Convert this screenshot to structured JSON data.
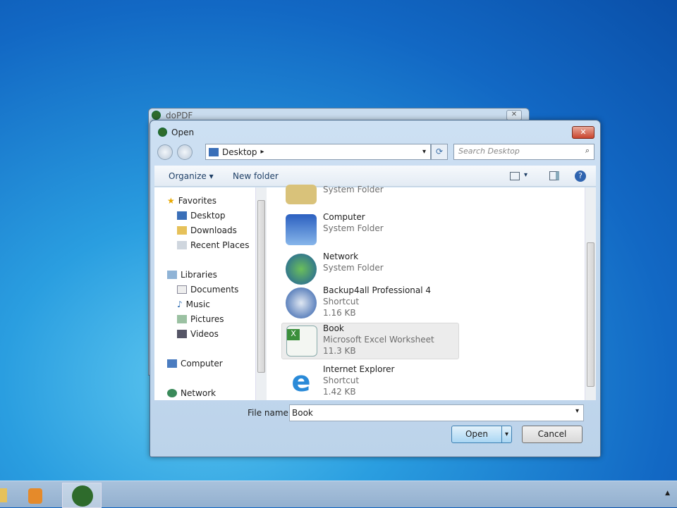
{
  "background_window": {
    "title": "doPDF",
    "close": "✕"
  },
  "dialog": {
    "title": "Open",
    "close": "✕",
    "address": {
      "path": "Desktop",
      "arrow": "▸",
      "dropdown": "▾",
      "refresh": "⟳"
    },
    "search": {
      "placeholder": "Search Desktop",
      "icon": "⌕"
    },
    "toolbar": {
      "organize": "Organize ▾",
      "new_folder": "New folder",
      "views": "▾",
      "help": "?"
    },
    "nav": {
      "favorites": "Favorites",
      "items_fav": [
        "Desktop",
        "Downloads",
        "Recent Places"
      ],
      "libraries": "Libraries",
      "items_lib": [
        "Documents",
        "Music",
        "Pictures",
        "Videos"
      ],
      "computer": "Computer",
      "network": "Network"
    },
    "files": [
      {
        "name": "",
        "type": "System Folder",
        "size": ""
      },
      {
        "name": "Computer",
        "type": "System Folder",
        "size": ""
      },
      {
        "name": "Network",
        "type": "System Folder",
        "size": ""
      },
      {
        "name": "Backup4all Professional 4",
        "type": "Shortcut",
        "size": "1.16 KB"
      },
      {
        "name": "Book",
        "type": "Microsoft Excel Worksheet",
        "size": "11.3 KB"
      },
      {
        "name": "Internet Explorer",
        "type": "Shortcut",
        "size": "1.42 KB"
      }
    ],
    "file_name_label": "File name:",
    "file_name_value": "Book",
    "open": "Open",
    "cancel": "Cancel"
  },
  "colors": {
    "accent": "#3c7fb1",
    "desktop": "#1268c4"
  }
}
